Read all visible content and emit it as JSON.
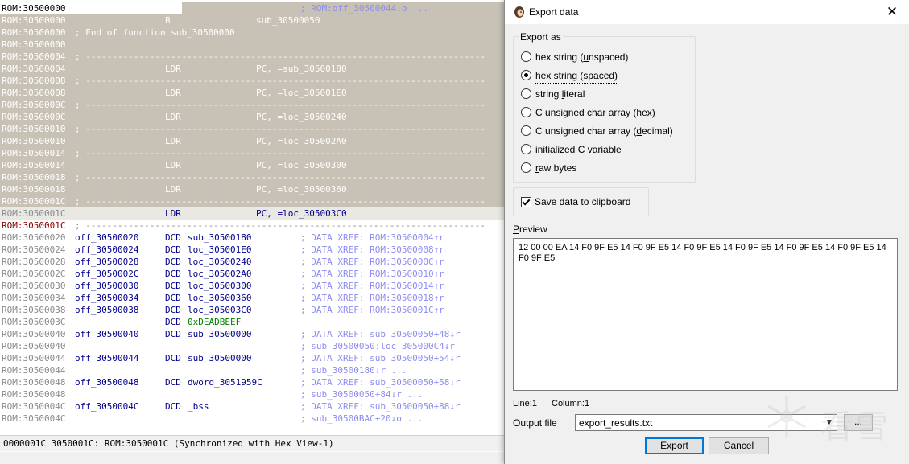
{
  "listing": {
    "rows": [
      {
        "addr": "ROM:30500000",
        "cmt": "; ROM:off_30500044↓o ...",
        "type": "first"
      },
      {
        "addr": "ROM:30500000",
        "mn": "B",
        "op2": "sub_30500050",
        "type": "sel"
      },
      {
        "addr": "ROM:30500000",
        "wide": "; End of function sub_30500000",
        "type": "sel"
      },
      {
        "addr": "ROM:30500000",
        "type": "sel"
      },
      {
        "addr": "ROM:30500004",
        "dash": "; ---------------------------------------------------------------------------",
        "type": "sel"
      },
      {
        "addr": "ROM:30500004",
        "mn": "LDR",
        "op2": "PC, =sub_30500180",
        "type": "sel"
      },
      {
        "addr": "ROM:30500008",
        "dash": "; ---------------------------------------------------------------------------",
        "type": "sel"
      },
      {
        "addr": "ROM:30500008",
        "mn": "LDR",
        "op2": "PC, =loc_305001E0",
        "type": "sel"
      },
      {
        "addr": "ROM:3050000C",
        "dash": "; ---------------------------------------------------------------------------",
        "type": "sel"
      },
      {
        "addr": "ROM:3050000C",
        "mn": "LDR",
        "op2": "PC, =loc_30500240",
        "type": "sel"
      },
      {
        "addr": "ROM:30500010",
        "dash": "; ---------------------------------------------------------------------------",
        "type": "sel"
      },
      {
        "addr": "ROM:30500010",
        "mn": "LDR",
        "op2": "PC, =loc_305002A0",
        "type": "sel"
      },
      {
        "addr": "ROM:30500014",
        "dash": "; ---------------------------------------------------------------------------",
        "type": "sel"
      },
      {
        "addr": "ROM:30500014",
        "mn": "LDR",
        "op2": "PC, =loc_30500300",
        "type": "sel"
      },
      {
        "addr": "ROM:30500018",
        "dash": "; ---------------------------------------------------------------------------",
        "type": "sel"
      },
      {
        "addr": "ROM:30500018",
        "mn": "LDR",
        "op2": "PC, =loc_30500360",
        "type": "sel"
      },
      {
        "addr": "ROM:3050001C",
        "dash": "; ---------------------------------------------------------------------------",
        "type": "sel"
      },
      {
        "addr": "ROM:3050001C",
        "mn": "LDR",
        "op2": "PC, =loc_305003C0",
        "type": "cur"
      },
      {
        "addr": "ROM:3050001C",
        "dash": "; ---------------------------------------------------------------------------",
        "type": "red"
      },
      {
        "addr": "ROM:30500020",
        "lbl": "off_30500020",
        "mn": "DCD",
        "op": "sub_30500180",
        "cmt": "; DATA XREF: ROM:30500004↑r",
        "type": "plain"
      },
      {
        "addr": "ROM:30500024",
        "lbl": "off_30500024",
        "mn": "DCD",
        "op": "loc_305001E0",
        "cmt": "; DATA XREF: ROM:30500008↑r",
        "type": "plain"
      },
      {
        "addr": "ROM:30500028",
        "lbl": "off_30500028",
        "mn": "DCD",
        "op": "loc_30500240",
        "cmt": "; DATA XREF: ROM:3050000C↑r",
        "type": "plain"
      },
      {
        "addr": "ROM:3050002C",
        "lbl": "off_3050002C",
        "mn": "DCD",
        "op": "loc_305002A0",
        "cmt": "; DATA XREF: ROM:30500010↑r",
        "type": "plain"
      },
      {
        "addr": "ROM:30500030",
        "lbl": "off_30500030",
        "mn": "DCD",
        "op": "loc_30500300",
        "cmt": "; DATA XREF: ROM:30500014↑r",
        "type": "plain"
      },
      {
        "addr": "ROM:30500034",
        "lbl": "off_30500034",
        "mn": "DCD",
        "op": "loc_30500360",
        "cmt": "; DATA XREF: ROM:30500018↑r",
        "type": "plain"
      },
      {
        "addr": "ROM:30500038",
        "lbl": "off_30500038",
        "mn": "DCD",
        "op": "loc_305003C0",
        "cmt": "; DATA XREF: ROM:3050001C↑r",
        "type": "plain"
      },
      {
        "addr": "ROM:3050003C",
        "mn": "DCD",
        "op": "0xDEADBEEF",
        "type": "green"
      },
      {
        "addr": "ROM:30500040",
        "lbl": "off_30500040",
        "mn": "DCD",
        "op": "sub_30500000",
        "cmt": "; DATA XREF: sub_30500050+48↓r",
        "type": "plain"
      },
      {
        "addr": "ROM:30500040",
        "cmt": "; sub_30500050:loc_305000C4↓r",
        "type": "plain"
      },
      {
        "addr": "ROM:30500044",
        "lbl": "off_30500044",
        "mn": "DCD",
        "op": "sub_30500000",
        "cmt": "; DATA XREF: sub_30500050+54↓r",
        "type": "plain"
      },
      {
        "addr": "ROM:30500044",
        "cmt": "; sub_30500180↓r ...",
        "type": "plain"
      },
      {
        "addr": "ROM:30500048",
        "lbl": "off_30500048",
        "mn": "DCD",
        "op": "dword_3051959C",
        "cmt": "; DATA XREF: sub_30500050+58↓r",
        "type": "plain"
      },
      {
        "addr": "ROM:30500048",
        "cmt": "; sub_30500050+84↓r ...",
        "type": "plain"
      },
      {
        "addr": "ROM:3050004C",
        "lbl": "off_3050004C",
        "mn": "DCD",
        "op": "_bss",
        "cmt": "; DATA XREF: sub_30500050+88↓r",
        "type": "plain"
      },
      {
        "addr": "ROM:3050004C",
        "cmt": "; sub_30500BAC+20↓o ...",
        "type": "plain"
      }
    ],
    "status": "0000001C 3050001C: ROM:3050001C (Synchronized with Hex View-1)"
  },
  "dialog": {
    "title": "Export data",
    "close_glyph": "✕",
    "export_as_label": "Export as",
    "options": [
      {
        "pre": "hex string (",
        "u": "u",
        "post": "nspaced)",
        "selected": false
      },
      {
        "pre": "hex string (",
        "u": "s",
        "post": "paced)",
        "selected": true
      },
      {
        "pre": "string ",
        "u": "l",
        "post": "iteral",
        "selected": false
      },
      {
        "pre": "C unsigned char array (",
        "u": "h",
        "post": "ex)",
        "selected": false
      },
      {
        "pre": "C unsigned char array (",
        "u": "d",
        "post": "ecimal)",
        "selected": false
      },
      {
        "pre": "initialized ",
        "u": "C",
        "post": " variable",
        "selected": false
      },
      {
        "pre": "",
        "u": "r",
        "post": "aw bytes",
        "selected": false
      }
    ],
    "save_clipboard_label": "Save data to clipboard",
    "save_clipboard_checked": true,
    "preview_label": "Preview",
    "preview_text": "12 00 00 EA 14 F0 9F E5 14 F0 9F E5 14 F0 9F E5 14 F0 9F E5 14 F0 9F E5 14 F0 9F E5 14 F0 9F E5",
    "line_label": "Line:1",
    "column_label": "Column:1",
    "output_file_label": "Output file",
    "output_file_value": "export_results.txt",
    "browse_label": "...",
    "export_button": "Export",
    "cancel_button": "Cancel"
  },
  "watermark": {
    "text": "看雪"
  },
  "colors": {
    "selection": "#c7c2b5",
    "accent": "#0078d7",
    "comment": "#8d8df0",
    "code": "#00008b",
    "constant": "#008000"
  }
}
